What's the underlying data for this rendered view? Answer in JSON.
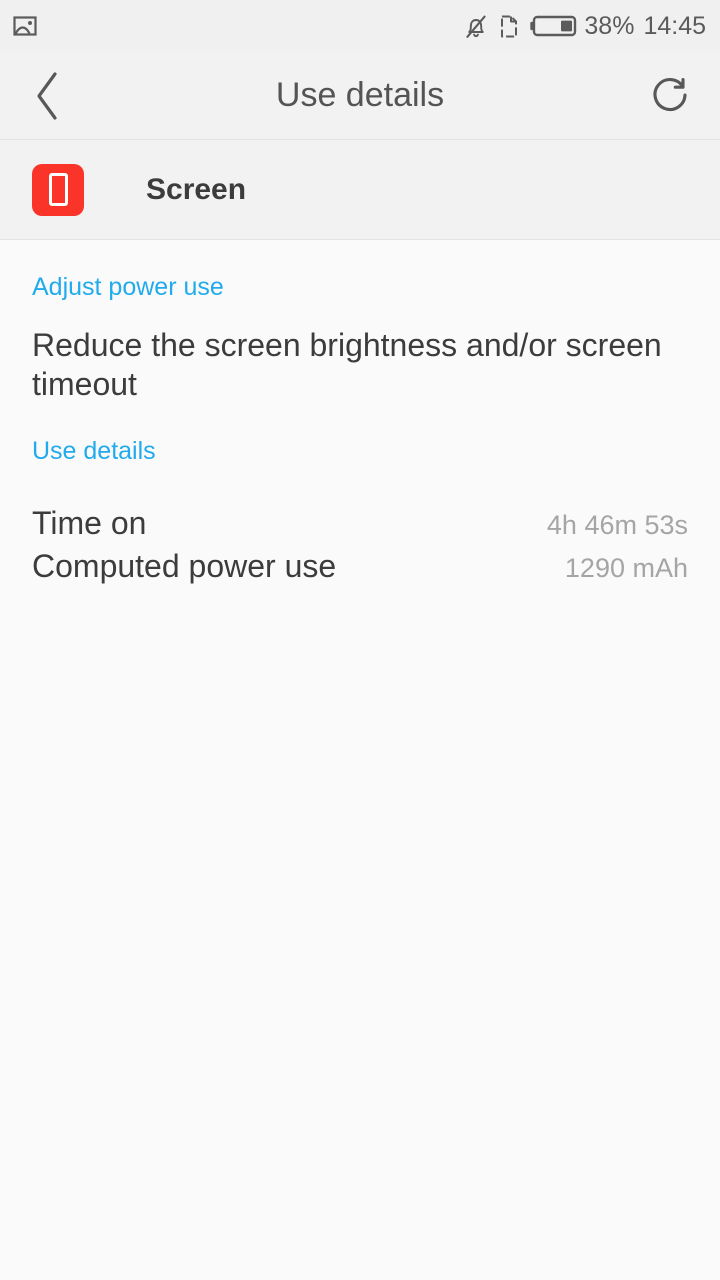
{
  "statusbar": {
    "left_icons": [
      {
        "name": "screenshot-image-icon"
      }
    ],
    "right_icons": [
      {
        "name": "bell-muted-icon"
      },
      {
        "name": "document-alert-icon"
      },
      {
        "name": "battery-icon"
      }
    ],
    "battery_percent": "38%",
    "battery_level": 38,
    "time": "14:45"
  },
  "appbar": {
    "back_icon": "chevron-left-icon",
    "title": "Use details",
    "refresh_icon": "refresh-icon"
  },
  "app_header": {
    "icon": "screen-app-icon",
    "icon_color": "#FA3429",
    "name": "Screen"
  },
  "sections": {
    "adjust": {
      "header": "Adjust power use",
      "body": "Reduce the screen brightness and/or screen timeout"
    },
    "use_details": {
      "header": "Use details",
      "rows": [
        {
          "label": "Time on",
          "value": "4h 46m 53s"
        },
        {
          "label": "Computed power use",
          "value": "1290 mAh"
        }
      ]
    }
  },
  "colors": {
    "accent": "#21ABEC",
    "app_icon_red": "#FA3429",
    "text_primary": "#3C3C3C",
    "text_secondary": "#A5A5A5",
    "bar_bg": "#F2F2F2",
    "page_bg": "#FAFAFA"
  }
}
